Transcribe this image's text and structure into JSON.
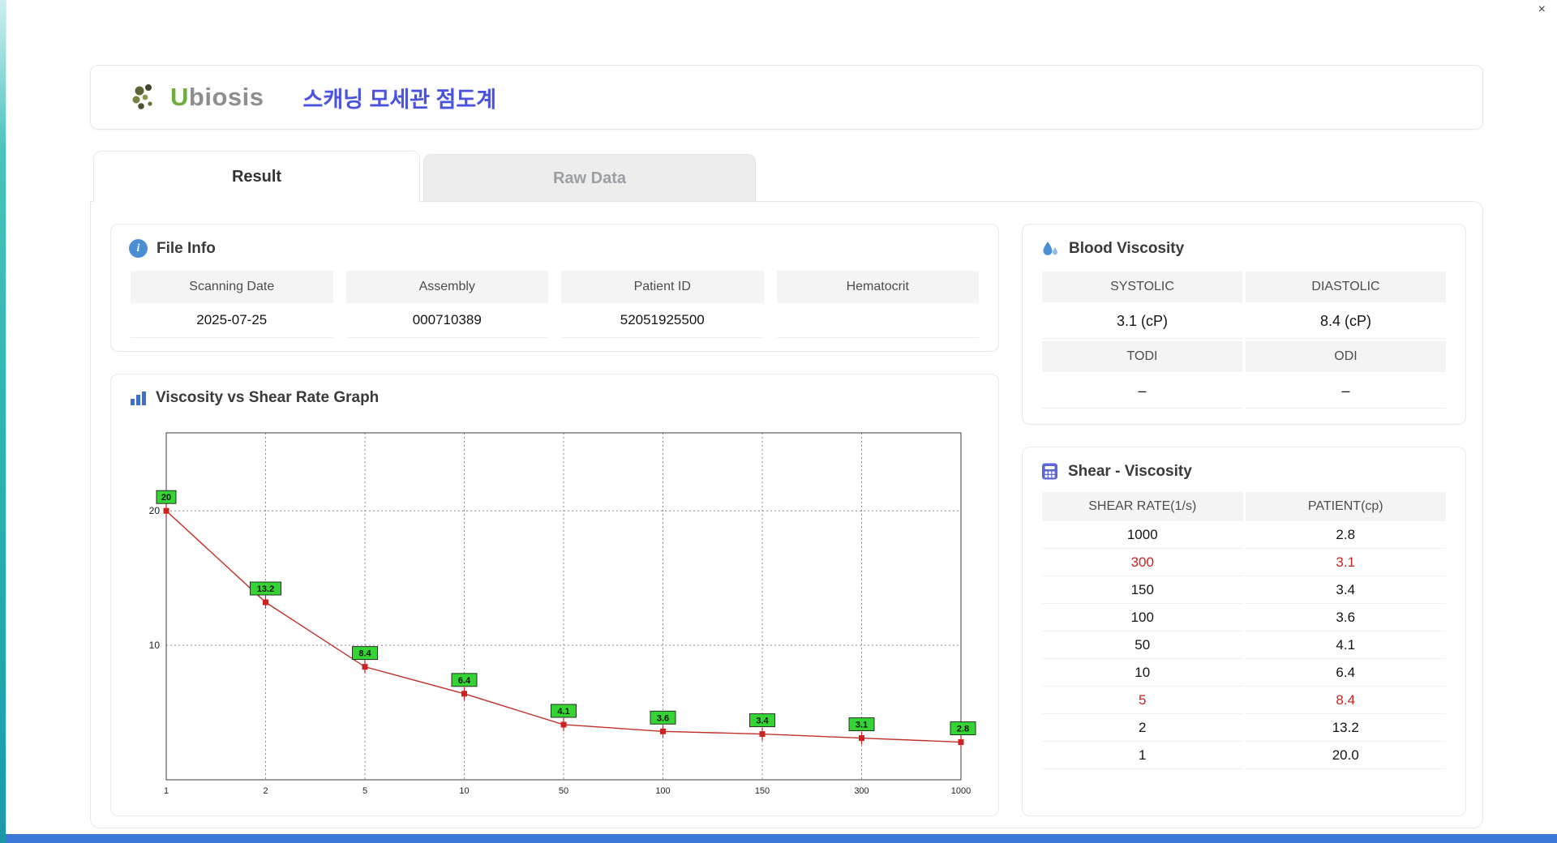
{
  "window": {
    "close_label": "×"
  },
  "header": {
    "logo_text_accent": "U",
    "logo_text_rest": "biosis",
    "title": "스캐닝 모세관 점도계"
  },
  "tabs": {
    "result": "Result",
    "raw_data": "Raw Data"
  },
  "file_info": {
    "title": "File Info",
    "fields": [
      {
        "label": "Scanning Date",
        "value": "2025-07-25"
      },
      {
        "label": "Assembly",
        "value": "000710389"
      },
      {
        "label": "Patient ID",
        "value": "52051925500"
      },
      {
        "label": "Hematocrit",
        "value": ""
      }
    ]
  },
  "graph": {
    "title": "Viscosity vs Shear Rate Graph"
  },
  "chart_data": {
    "type": "line",
    "title": "Viscosity vs Shear Rate Graph",
    "xlabel": "",
    "ylabel": "",
    "x": [
      1,
      2,
      5,
      10,
      50,
      100,
      150,
      300,
      1000
    ],
    "x_ticks": [
      "1",
      "2",
      "5",
      "10",
      "50",
      "100",
      "150",
      "300",
      "1000"
    ],
    "x_scale": "log-category",
    "values": [
      20,
      13.2,
      8.4,
      6.4,
      4.1,
      3.6,
      3.4,
      3.1,
      2.8
    ],
    "point_labels": [
      "20",
      "13.2",
      "8.4",
      "6.4",
      "4.1",
      "3.6",
      "3.4",
      "3.1",
      "2.8"
    ],
    "y_ticks": [
      10,
      20
    ],
    "ylim": [
      0,
      25.8
    ],
    "grid": "dotted",
    "legend": "none",
    "line_color": "#c03028",
    "marker_color": "#cc2222",
    "label_bg": "#33d433"
  },
  "blood_viscosity": {
    "title": "Blood Viscosity",
    "row1": {
      "h1": "SYSTOLIC",
      "h2": "DIASTOLIC",
      "v1": "3.1 (cP)",
      "v2": "8.4 (cP)"
    },
    "row2": {
      "h1": "TODI",
      "h2": "ODI",
      "v1": "–",
      "v2": "–"
    }
  },
  "shear_viscosity": {
    "title": "Shear - Viscosity",
    "columns": {
      "c1": "SHEAR RATE(1/s)",
      "c2": "PATIENT(cp)"
    },
    "rows": [
      {
        "shear_rate": "1000",
        "patient": "2.8",
        "highlight": false
      },
      {
        "shear_rate": "300",
        "patient": "3.1",
        "highlight": true
      },
      {
        "shear_rate": "150",
        "patient": "3.4",
        "highlight": false
      },
      {
        "shear_rate": "100",
        "patient": "3.6",
        "highlight": false
      },
      {
        "shear_rate": "50",
        "patient": "4.1",
        "highlight": false
      },
      {
        "shear_rate": "10",
        "patient": "6.4",
        "highlight": false
      },
      {
        "shear_rate": "5",
        "patient": "8.4",
        "highlight": true
      },
      {
        "shear_rate": "2",
        "patient": "13.2",
        "highlight": false
      },
      {
        "shear_rate": "1",
        "patient": "20.0",
        "highlight": false
      }
    ]
  }
}
